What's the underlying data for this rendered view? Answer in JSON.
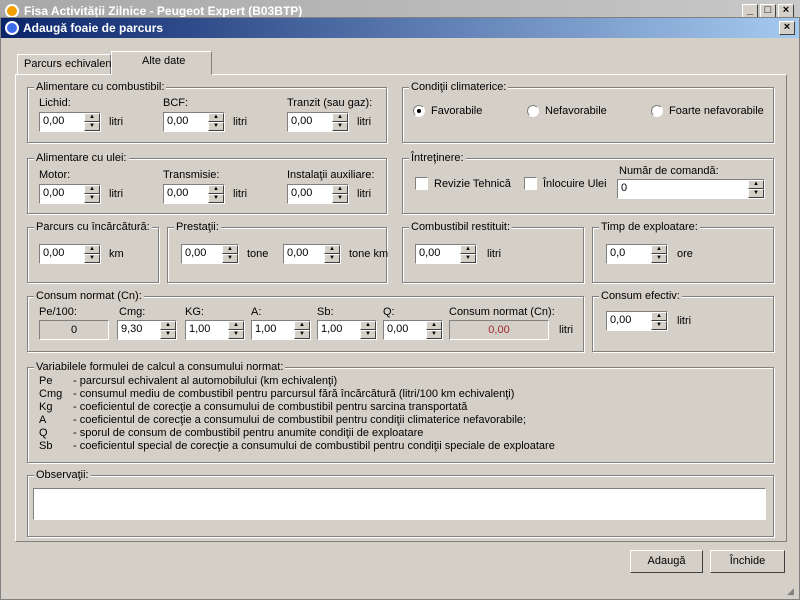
{
  "outer_window": {
    "title": "Fisa Activității Zilnice - Peugeot Expert (B03BTP)"
  },
  "dialog": {
    "title": "Adaugă foaie de parcurs"
  },
  "tabs": [
    {
      "label": "Parcurs echivalent"
    },
    {
      "label": "Alte date"
    }
  ],
  "combustibil": {
    "title": "Alimentare cu combustibil:",
    "lichid": {
      "label": "Lichid:",
      "value": "0,00",
      "unit": "litri"
    },
    "bcf": {
      "label": "BCF:",
      "value": "0,00",
      "unit": "litri"
    },
    "tranzit": {
      "label": "Tranzit (sau gaz):",
      "value": "0,00",
      "unit": "litri"
    }
  },
  "conditii": {
    "title": "Condiţii climaterice:",
    "options": [
      "Favorabile",
      "Nefavorabile",
      "Foarte nefavorabile"
    ],
    "selected": "Favorabile"
  },
  "ulei": {
    "title": "Alimentare cu ulei:",
    "motor": {
      "label": "Motor:",
      "value": "0,00",
      "unit": "litri"
    },
    "transmisie": {
      "label": "Transmisie:",
      "value": "0,00",
      "unit": "litri"
    },
    "instalatii": {
      "label": "Instalaţii auxiliare:",
      "value": "0,00",
      "unit": "litri"
    }
  },
  "intretinere": {
    "title": "Întreţinere:",
    "revizie": "Revizie Tehnică",
    "inlocuire": "Înlocuire Ulei",
    "comanda_label": "Număr de comandă:",
    "comanda_value": "0"
  },
  "parcurs_incarcatura": {
    "title": "Parcurs cu încărcătură:",
    "value": "0,00",
    "unit": "km"
  },
  "prestatii": {
    "title": "Prestaţii:",
    "tone": "0,00",
    "tone_unit": "tone",
    "tonekm": "0,00",
    "tonekm_unit": "tone km"
  },
  "combustibil_restituit": {
    "title": "Combustibil restituit:",
    "value": "0,00",
    "unit": "litri"
  },
  "timp_exploatare": {
    "title": "Timp de exploatare:",
    "value": "0,0",
    "unit": "ore"
  },
  "consum_normat": {
    "title": "Consum normat (Cn):",
    "pe100_label": "Pe/100:",
    "pe100_value": "0",
    "cmg_label": "Cmg:",
    "cmg_value": "9,30",
    "kg_label": "KG:",
    "kg_value": "1,00",
    "a_label": "A:",
    "a_value": "1,00",
    "sb_label": "Sb:",
    "sb_value": "1,00",
    "q_label": "Q:",
    "q_value": "0,00",
    "cn_label": "Consum normat (Cn):",
    "cn_value": "0,00",
    "unit": "litri"
  },
  "consum_efectiv": {
    "title": "Consum efectiv:",
    "value": "0,00",
    "unit": "litri"
  },
  "variabile": {
    "title": "Variabilele formulei de calcul a consumului normat:",
    "rows": [
      {
        "k": "Pe",
        "d": "- parcursul echivalent al automobilului (km echivalenţi)"
      },
      {
        "k": "Cmg",
        "d": "- consumul mediu de combustibil pentru parcursul fără încărcătură (litri/100 km echivalenţi)"
      },
      {
        "k": "Kg",
        "d": "- coeficientul de corecţie a consumului de combustibil pentru sarcina transportată"
      },
      {
        "k": "A",
        "d": "- coeficientul de corecţie a consumului de combustibil pentru condiţii climaterice nefavorabile;"
      },
      {
        "k": "Q",
        "d": "- sporul de consum de combustibil pentru anumite condiţii de exploatare"
      },
      {
        "k": "Sb",
        "d": "- coeficientul special de corecţie a consumului de combustibil pentru condiţii speciale de exploatare"
      }
    ]
  },
  "observatii": {
    "title": "Observaţii:",
    "value": ""
  },
  "buttons": {
    "add": "Adaugă",
    "close": "Închide"
  }
}
